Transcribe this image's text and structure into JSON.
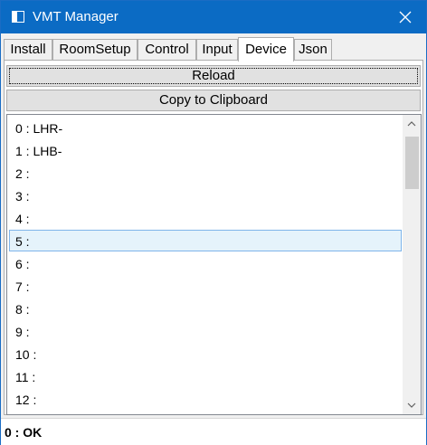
{
  "window": {
    "title": "VMT Manager"
  },
  "titlebar": {
    "icon": "app-window-icon",
    "close_icon": "close-icon"
  },
  "tabs": [
    {
      "label": "Install",
      "active": false
    },
    {
      "label": "RoomSetup",
      "active": false
    },
    {
      "label": "Control",
      "active": false
    },
    {
      "label": "Input",
      "active": false
    },
    {
      "label": "Device",
      "active": true
    },
    {
      "label": "Json",
      "active": false
    }
  ],
  "device_panel": {
    "reload_label": "Reload",
    "copy_label": "Copy to Clipboard",
    "devices": [
      "0 : LHR-",
      "1 : LHB-",
      "2 :",
      "3 :",
      "4 :",
      "5 :",
      "6 :",
      "7 :",
      "8 :",
      "9 :",
      "10 :",
      "11 :",
      "12 :"
    ],
    "selected_index": 5
  },
  "status": {
    "text": "0 : OK"
  },
  "colors": {
    "titlebar": "#0b6bc4",
    "selection_fill": "#e5f3fb",
    "selection_border": "#7eb4ea"
  }
}
